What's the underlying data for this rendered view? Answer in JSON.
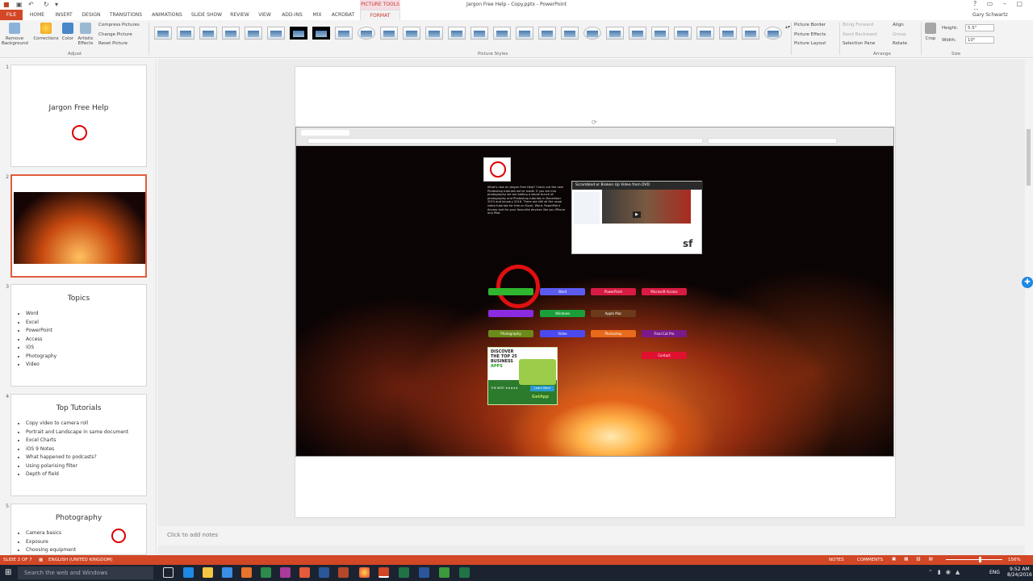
{
  "app": {
    "title": "Jargon Free Help - Copy.pptx - PowerPoint",
    "contextual_group": "PICTURE TOOLS",
    "user": "Gary Schwartz",
    "window_controls": "? ▭ – ▢ ✕"
  },
  "tabs": [
    "FILE",
    "HOME",
    "INSERT",
    "DESIGN",
    "TRANSITIONS",
    "ANIMATIONS",
    "SLIDE SHOW",
    "REVIEW",
    "VIEW",
    "ADD-INS",
    "MIX",
    "ACROBAT",
    "FORMAT"
  ],
  "ribbon": {
    "adjust": {
      "remove_background": "Remove Background",
      "corrections": "Corrections",
      "color": "Color",
      "artistic_effects": "Artistic Effects",
      "compress": "Compress Pictures",
      "change": "Change Picture",
      "reset": "Reset Picture",
      "group_label": "Adjust"
    },
    "styles_group_label": "Picture Styles",
    "picture_border": "Picture Border",
    "picture_effects": "Picture Effects",
    "picture_layout": "Picture Layout",
    "arrange": {
      "bring_forward": "Bring Forward",
      "send_backward": "Send Backward",
      "selection_pane": "Selection Pane",
      "align": "Align",
      "group": "Group",
      "rotate": "Rotate",
      "group_label": "Arrange"
    },
    "size": {
      "crop": "Crop",
      "height_label": "Height:",
      "height_value": "5.5\"",
      "width_label": "Width:",
      "width_value": "10\"",
      "group_label": "Size"
    }
  },
  "thumbnails": [
    {
      "num": "1",
      "title": "Jargon Free Help",
      "items": []
    },
    {
      "num": "2",
      "title": "",
      "items": []
    },
    {
      "num": "3",
      "title": "Topics",
      "items": [
        "Word",
        "Excel",
        "PowerPoint",
        "Access",
        "iOS",
        "Photography",
        "Video"
      ]
    },
    {
      "num": "4",
      "title": "Top Tutorials",
      "items": [
        "Copy video to camera roll",
        "Portrait and Landscape in same document",
        "Excel Charts",
        "iOS 9 Notes",
        "What happened to podcasts?",
        "Using polarising filter",
        "Depth of field"
      ]
    },
    {
      "num": "5",
      "title": "Photography",
      "items": [
        "Camera basics",
        "Exposure",
        "Choosing equipment"
      ]
    }
  ],
  "slide": {
    "website_text": "What's new on Jargon Free Help? Check out the new Photoshop tutorials we've made. If you are into photography we are adding a whole bunch of photography and Photoshop tutorials in December 2015 and January 2016. There are still all the usual video tutorials for free on Excel, Word, PowerPoint Access and for your favourite devices like you iPhone and iPad.",
    "video_title": "Scrambled or Broken Up Video from DVD",
    "buttons": {
      "word": "Word",
      "powerpoint": "PowerPoint",
      "access": "Microsoft Access",
      "windows": "Windows",
      "apple_mac": "Apple Mac",
      "photography": "Photography",
      "video": "Video",
      "photoshop": "Photoshop",
      "free_cut_pro": "Final Cut Pro",
      "contact": "Contact"
    },
    "ad": {
      "line1": "DISCOVER",
      "line2": "THE TOP 25",
      "line3": "BUSINESS",
      "line4": "APPS",
      "cta": "Learn More",
      "brand": "GetApp",
      "tag": "THE BEST ★★★★★"
    },
    "sf_logo": "sf"
  },
  "notes_placeholder": "Click to add notes",
  "status": {
    "slide": "SLIDE 2 OF 7",
    "language": "ENGLISH (UNITED KINGDOM)",
    "notes": "NOTES",
    "comments": "COMMENTS",
    "zoom": "156%"
  },
  "taskbar": {
    "search": "Search the web and Windows",
    "time": "9:52 AM",
    "date": "8/24/2016",
    "lang": "ENG"
  },
  "colors": {
    "accent": "#d24726",
    "taskbar": "#1b2331"
  }
}
